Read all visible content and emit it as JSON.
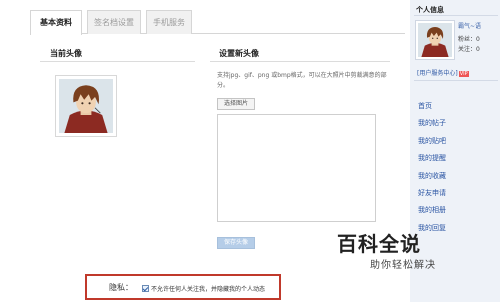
{
  "tabs": [
    {
      "label": "基本资料",
      "active": true
    },
    {
      "label": "签名档设置",
      "active": false
    },
    {
      "label": "手机服务",
      "active": false
    }
  ],
  "current_avatar": {
    "title": "当前头像"
  },
  "set_avatar": {
    "title": "设置新头像",
    "hint": "支持jpg、gif、png 或bmp格式，可以在大照片中剪裁满意的部分。",
    "choose_button": "选择图片",
    "save_button": "保存头像"
  },
  "privacy": {
    "label": "隐私：",
    "checkbox_checked": true,
    "checkbox_text": "不允许任何人关注我，并隐藏我的个人动态"
  },
  "sidebar": {
    "title": "个人信息",
    "username": "霸气~语",
    "fans": "粉丝：0",
    "following": "关注：0",
    "service_center": "[用户服务中心]",
    "vip_badge": "VIP",
    "menu": [
      "首页",
      "我的帖子",
      "我的贴吧",
      "我的提醒",
      "我的收藏",
      "好友申请",
      "我的相册",
      "我的回复"
    ]
  },
  "watermark": {
    "main": "百科全说",
    "sub": "助你轻松解决"
  },
  "colors": {
    "accent_link": "#2b55a3",
    "highlight_border": "#c0392b",
    "save_button_bg": "#b5cde8"
  }
}
